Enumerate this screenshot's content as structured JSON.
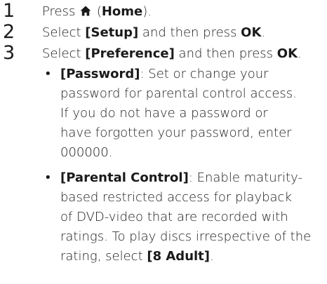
{
  "steps": [
    {
      "number": "1",
      "pre": "Press ",
      "icon": "home-icon",
      "mid": " (",
      "bold": "Home",
      "post": ")."
    },
    {
      "number": "2",
      "pre": "Select ",
      "bold1": "[Setup]",
      "mid": " and then press ",
      "bold2": "OK",
      "post": "."
    },
    {
      "number": "3",
      "pre": "Select ",
      "bold1": "[Preference]",
      "mid": " and then press ",
      "bold2": "OK",
      "post": "."
    }
  ],
  "bullets": [
    {
      "marker": "•",
      "term": "[Password]",
      "lines": [
        ": Set or change your",
        "password for parental control access.",
        "If you do not have a password or",
        "have forgotten your password, enter",
        "000000."
      ]
    },
    {
      "marker": "•",
      "term": "[Parental Control]",
      "lines": [
        ": Enable maturity-",
        "based restricted access for playback",
        "of DVD-video that are recorded with",
        "ratings. To play discs irrespective of the",
        "rating, select "
      ],
      "term2": "[8 Adult]",
      "end": "."
    }
  ]
}
